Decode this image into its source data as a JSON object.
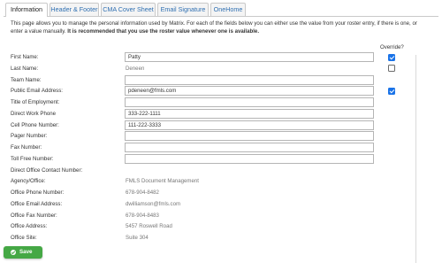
{
  "tabs": [
    "Information",
    "Header & Footer",
    "CMA Cover Sheet",
    "Email Signature",
    "OneHome"
  ],
  "intro": {
    "plain": "This page allows you to manage the personal information used by Matrix. For each of the fields below you can either use the value from your roster entry, if there is one, or enter a value manually.",
    "bold": "It is recommended that you use the roster value whenever one is available."
  },
  "override_header": "Override?",
  "fields": [
    {
      "label": "First Name:",
      "value": "Patty",
      "kind": "input",
      "override": true
    },
    {
      "label": "Last Name:",
      "value": "Deneen",
      "kind": "static",
      "override": false
    },
    {
      "label": "Team Name:",
      "value": "",
      "kind": "input"
    },
    {
      "label": "Public Email Address:",
      "value": "pdeneen@fmls.com",
      "kind": "input",
      "override": true
    },
    {
      "label": "Title of Employment:",
      "value": "",
      "kind": "input"
    },
    {
      "label": "Direct Work Phone",
      "value": "333-222-1111",
      "kind": "input"
    },
    {
      "label": "Cell Phone Number:",
      "value": "111-222-3333",
      "kind": "input"
    },
    {
      "label": "Pager Number:",
      "value": "",
      "kind": "input"
    },
    {
      "label": "Fax Number:",
      "value": "",
      "kind": "input"
    },
    {
      "label": "Toll Free Number:",
      "value": "",
      "kind": "input"
    },
    {
      "label": "Direct Office Contact Number:",
      "value": "",
      "kind": "none"
    },
    {
      "label": "Agency/Office:",
      "value": "FMLS Document Management",
      "kind": "static"
    },
    {
      "label": "Office Phone Number:",
      "value": "678-904-8482",
      "kind": "static"
    },
    {
      "label": "Office Email Address:",
      "value": "dwilliamson@fmls.com",
      "kind": "static"
    },
    {
      "label": "Office Fax Number:",
      "value": "678-904-8483",
      "kind": "static"
    },
    {
      "label": "Office Address:",
      "value": "5457 Roswell Road",
      "kind": "static"
    },
    {
      "label": "Office Site:",
      "value": "Suite 304",
      "kind": "static"
    }
  ],
  "save_label": "Save",
  "colors": {
    "accent": "#1a73e8",
    "save": "#45a845",
    "tab_link": "#2f6fb1"
  }
}
